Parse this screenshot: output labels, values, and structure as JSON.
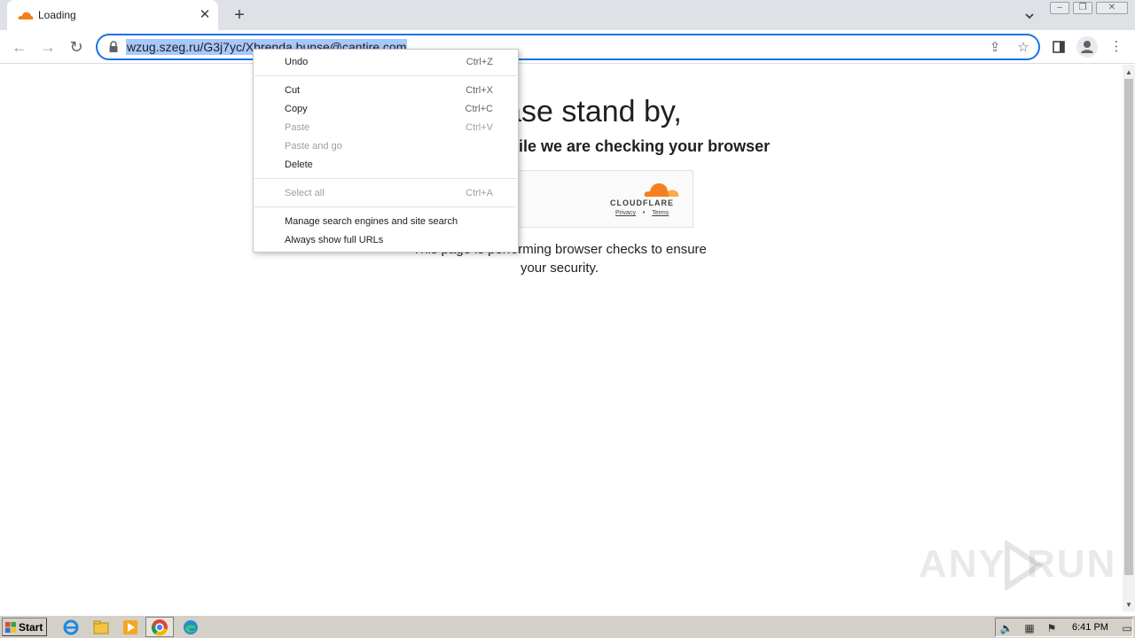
{
  "browser": {
    "tab": {
      "title": "Loading",
      "favicon": "cloudflare-icon",
      "close_icon": "close-icon"
    },
    "new_tab_icon": "plus-icon",
    "tab_search_icon": "chevron-down-icon",
    "window_controls": [
      "minimize-icon",
      "restore-icon",
      "close-icon"
    ],
    "address_bar": {
      "url": "wzug.szeg.ru/G3j7yc/Xbrenda.bunse@cantire.com",
      "selected": true
    }
  },
  "page": {
    "heading": "Please stand by,",
    "subheading": "while we are checking your browser",
    "widget": {
      "brand": "CLOUDFLARE",
      "privacy": "Privacy",
      "separator": "•",
      "terms": "Terms"
    },
    "body_text": "This page is performing browser checks to ensure your security."
  },
  "context_menu": {
    "items": [
      {
        "label": "Undo",
        "shortcut": "Ctrl+Z",
        "enabled": true
      },
      {
        "label": "Cut",
        "shortcut": "Ctrl+X",
        "enabled": true
      },
      {
        "label": "Copy",
        "shortcut": "Ctrl+C",
        "enabled": true
      },
      {
        "label": "Paste",
        "shortcut": "Ctrl+V",
        "enabled": false
      },
      {
        "label": "Paste and go",
        "shortcut": "",
        "enabled": false
      },
      {
        "label": "Delete",
        "shortcut": "",
        "enabled": true
      },
      {
        "label": "Select all",
        "shortcut": "Ctrl+A",
        "enabled": false
      },
      {
        "label": "Manage search engines and site search",
        "shortcut": "",
        "enabled": true
      },
      {
        "label": "Always show full URLs",
        "shortcut": "",
        "enabled": true
      }
    ]
  },
  "watermark": {
    "left": "ANY",
    "right": "RUN"
  },
  "taskbar": {
    "start_label": "Start",
    "clock": "6:41 PM"
  },
  "colors": {
    "accent": "#1a73e8",
    "selection": "#a8c7fa",
    "cloudflare_orange": "#f38020"
  }
}
